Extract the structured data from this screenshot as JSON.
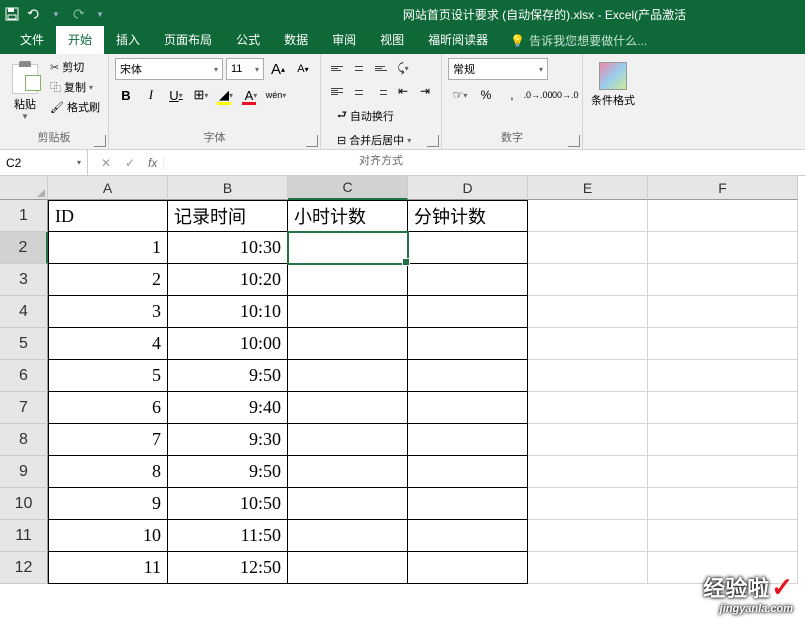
{
  "titlebar": {
    "title": "网站首页设计要求 (自动保存的).xlsx - Excel(产品激活"
  },
  "tabs": {
    "file": "文件",
    "home": "开始",
    "insert": "插入",
    "layout": "页面布局",
    "formula": "公式",
    "data": "数据",
    "review": "审阅",
    "view": "视图",
    "foxit": "福昕阅读器",
    "tellme": "告诉我您想要做什么..."
  },
  "ribbon": {
    "clipboard": {
      "paste": "粘贴",
      "cut": "剪切",
      "copy": "复制",
      "format_painter": "格式刷",
      "label": "剪贴板"
    },
    "font": {
      "name": "宋体",
      "size": "11",
      "aa_big": "A",
      "aa_small": "A",
      "b": "B",
      "i": "I",
      "u": "U",
      "label": "字体",
      "wen": "wén"
    },
    "align": {
      "wrap": "自动换行",
      "merge": "合并后居中",
      "label": "对齐方式"
    },
    "number": {
      "format": "常规",
      "label": "数字"
    },
    "cond": {
      "label": "条件格式"
    }
  },
  "formula_bar": {
    "name_box": "C2",
    "fx": "fx",
    "value": ""
  },
  "columns": [
    "A",
    "B",
    "C",
    "D",
    "E",
    "F"
  ],
  "row_nums": [
    "1",
    "2",
    "3",
    "4",
    "5",
    "6",
    "7",
    "8",
    "9",
    "10",
    "11",
    "12"
  ],
  "headers": {
    "A": "ID",
    "B": "记录时间",
    "C": "小时计数",
    "D": "分钟计数"
  },
  "rows": [
    {
      "id": "1",
      "time": "10:30"
    },
    {
      "id": "2",
      "time": "10:20"
    },
    {
      "id": "3",
      "time": "10:10"
    },
    {
      "id": "4",
      "time": "10:00"
    },
    {
      "id": "5",
      "time": "9:50"
    },
    {
      "id": "6",
      "time": "9:40"
    },
    {
      "id": "7",
      "time": "9:30"
    },
    {
      "id": "8",
      "time": "9:50"
    },
    {
      "id": "9",
      "time": "10:50"
    },
    {
      "id": "10",
      "time": "11:50"
    },
    {
      "id": "11",
      "time": "12:50"
    }
  ],
  "watermark": {
    "main": "经验啦",
    "sub": "jingyanla.com"
  }
}
